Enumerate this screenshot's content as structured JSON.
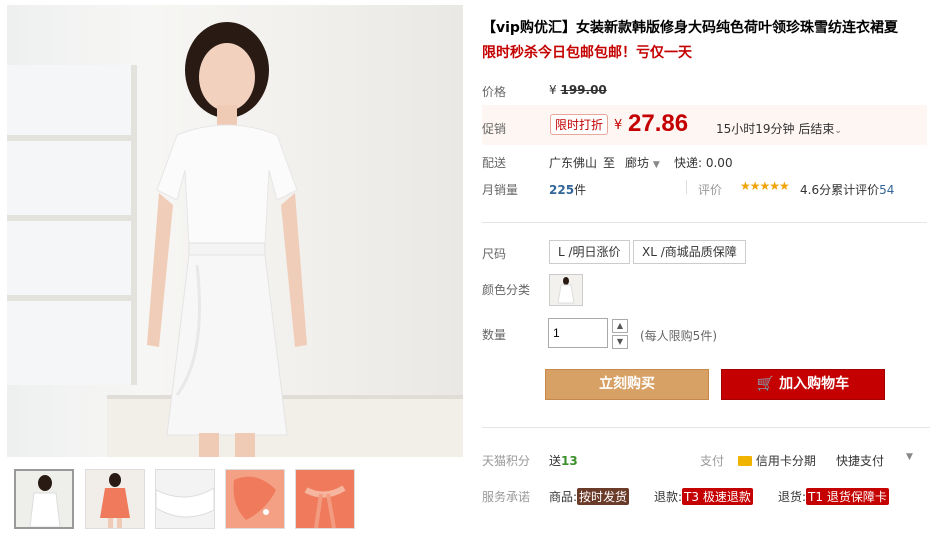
{
  "product": {
    "title": "【vip购优汇】女装新款韩版修身大码纯色荷叶领珍珠雪纺连衣裙夏",
    "promo_text": "限时秒杀今日包邮包邮！亏仅一天"
  },
  "price": {
    "label": "价格",
    "currency": "¥",
    "original": "199.00"
  },
  "promotion": {
    "label": "促销",
    "tag": "限时打折",
    "currency": "¥",
    "price": "27.86",
    "countdown": "15小时19分钟 后结束"
  },
  "shipping": {
    "label": "配送",
    "from": "广东佛山",
    "to_word": "至",
    "destination": "廊坊",
    "fee": "快递: 0.00"
  },
  "sales": {
    "label": "月销量",
    "count": "225",
    "unit": "件",
    "review_label": "评价",
    "stars": "★★★★★",
    "rating_text": "4.6分",
    "review_count_label": "累计评价",
    "review_count": "54",
    "rating": 4.6
  },
  "size": {
    "label": "尺码",
    "options": [
      "L /明日涨价",
      "XL /商城品质保障"
    ]
  },
  "color": {
    "label": "颜色分类"
  },
  "quantity": {
    "label": "数量",
    "value": "1",
    "limit_note": "(每人限购5件)"
  },
  "actions": {
    "buy_now": "立刻购买",
    "add_to_cart": "加入购物车"
  },
  "points": {
    "label": "天猫积分",
    "prefix": "送",
    "value": "13"
  },
  "payment": {
    "label": "支付",
    "credit": "信用卡分期",
    "quick": "快捷支付"
  },
  "service": {
    "label": "服务承诺",
    "goods_prefix": "商品:",
    "goods_badge": "按时发货",
    "refund_prefix": "退款:",
    "refund_badge": "T3 极速退款",
    "return_prefix": "退货:",
    "return_badge": "T1 退货保障卡"
  },
  "colors": {
    "accent": "#c40000",
    "buy_button": "#d7a064",
    "cart_button": "#c40000",
    "points_green": "#3c8f2c"
  }
}
